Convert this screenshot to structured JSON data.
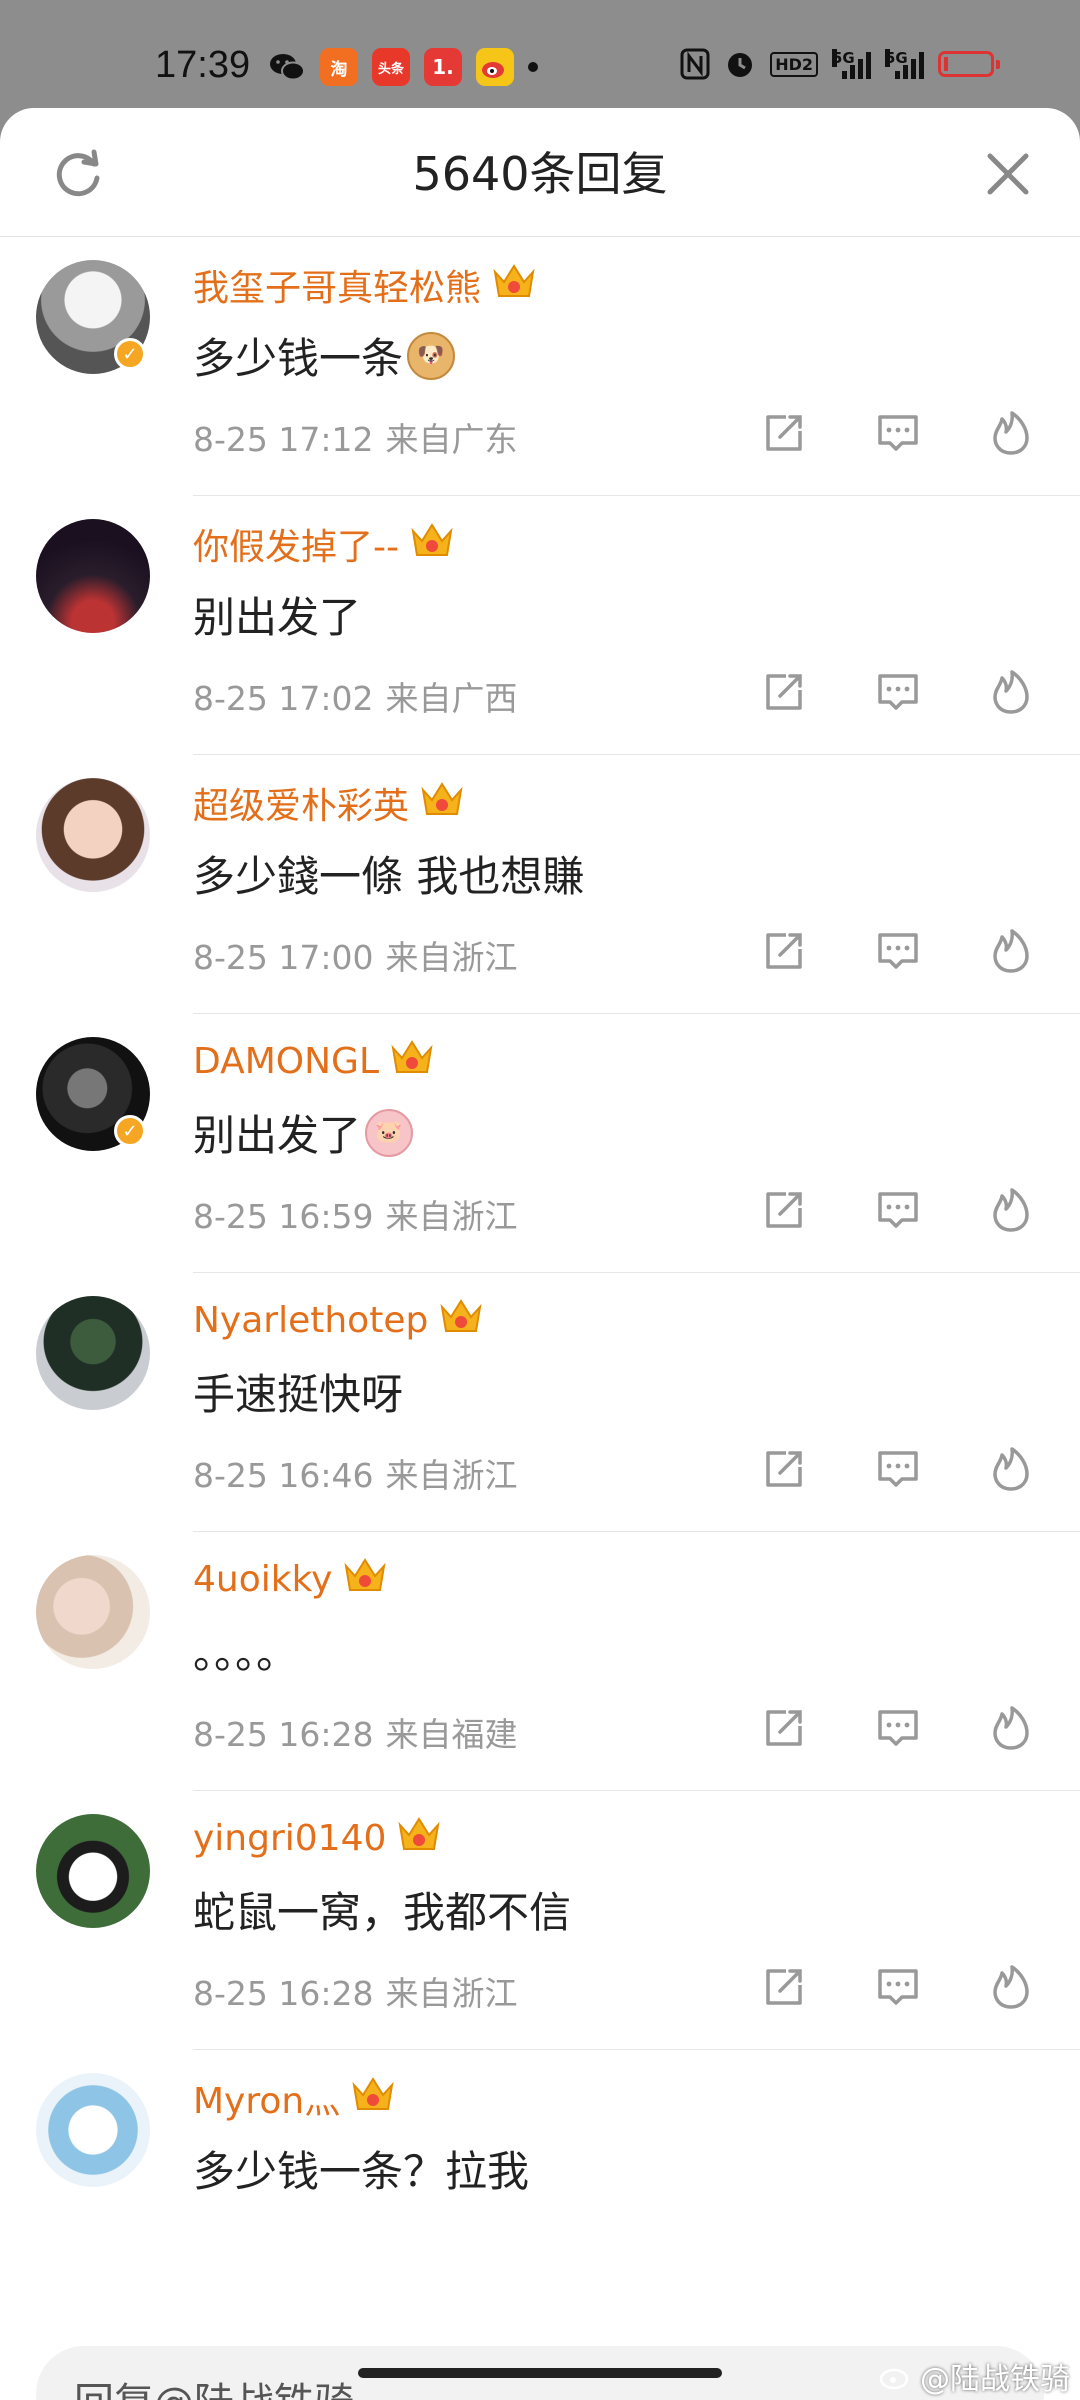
{
  "status_bar": {
    "time": "17:39",
    "apps": [
      {
        "name": "wechat-icon",
        "text": "",
        "color": "#8d8d8d"
      },
      {
        "name": "taobao-icon",
        "text": "淘",
        "color": "#f26f21"
      },
      {
        "name": "toutiao-icon",
        "text": "头条",
        "color": "#e8382a"
      },
      {
        "name": "one-app-icon",
        "text": "1.",
        "color": "#e53935"
      },
      {
        "name": "weibo-icon",
        "text": "",
        "color": "#f5c518"
      }
    ],
    "signal_1_label": "5G",
    "signal_2_label": "5G",
    "hd_label": "HD2",
    "battery_level": 0.08
  },
  "header": {
    "title": "5640条回复"
  },
  "comments": [
    {
      "user": "我玺子哥真轻松熊",
      "level": "4",
      "text": "多少钱一条",
      "emoji": "doge",
      "date": "8-25 17:12",
      "location": "来自广东",
      "verified": true
    },
    {
      "user": "你假发掉了--",
      "level": "4",
      "text": "别出发了",
      "emoji": "",
      "date": "8-25 17:02",
      "location": "来自广西",
      "verified": false
    },
    {
      "user": "超级爱朴彩英",
      "level": "3",
      "text": "多少錢一條 我也想賺",
      "emoji": "",
      "date": "8-25 17:00",
      "location": "来自浙江",
      "verified": false
    },
    {
      "user": "DAMONGL",
      "level": "7",
      "text": "别出发了",
      "emoji": "pig",
      "date": "8-25 16:59",
      "location": "来自浙江",
      "verified": true
    },
    {
      "user": "Nyarlethotep",
      "level": "5",
      "text": "手速挺快呀",
      "emoji": "",
      "date": "8-25 16:46",
      "location": "来自浙江",
      "verified": false
    },
    {
      "user": "4uoikky",
      "level": "5",
      "text": "。。。。",
      "emoji": "",
      "date": "8-25 16:28",
      "location": "来自福建",
      "verified": false
    },
    {
      "user": "yingri0140",
      "level": "3",
      "text": "蛇鼠一窝，我都不信",
      "emoji": "",
      "date": "8-25 16:28",
      "location": "来自浙江",
      "verified": false
    },
    {
      "user": "Myron灬",
      "level": "2",
      "text": "多少钱一条？拉我",
      "emoji": "",
      "date": "",
      "location": "",
      "verified": false
    }
  ],
  "reply_bar": {
    "placeholder": "回复@陆战铁骑"
  },
  "watermark": "@陆战铁骑"
}
